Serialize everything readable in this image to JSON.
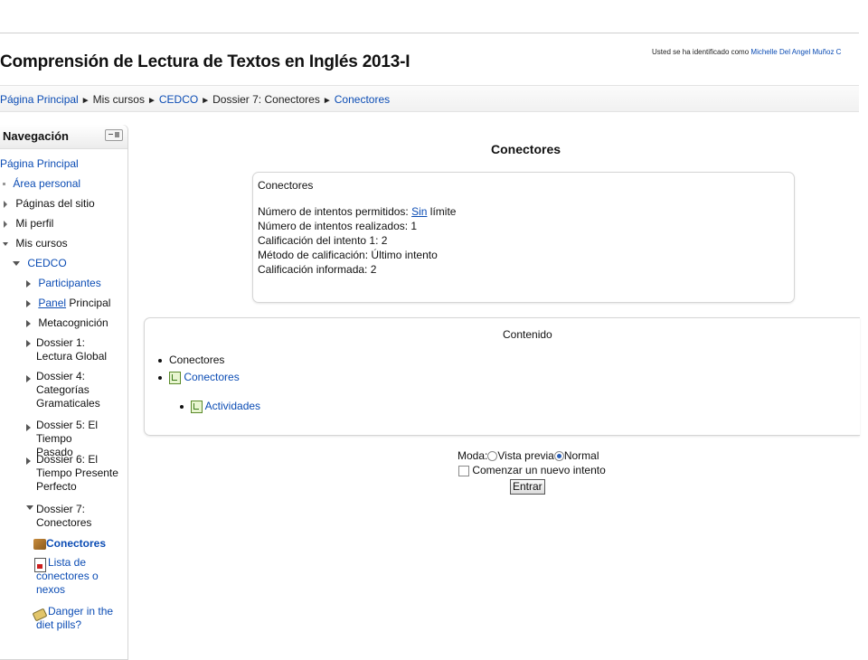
{
  "header": {
    "site_title": "Comprensión de Lectura de Textos en Inglés 2013-I",
    "login_prefix": "Usted se ha identificado como",
    "user_name": "Michelle Del Angel Muñoz C"
  },
  "breadcrumb": {
    "items": [
      "Página Principal",
      "Mis cursos",
      "CEDCO",
      "Dossier 7: Conectores",
      "Conectores"
    ],
    "separator": "►"
  },
  "navigation": {
    "title": "Navegación",
    "home": "Página Principal",
    "personal_area": "Área personal",
    "site_pages": "Páginas del sitio",
    "my_profile": "Mi perfil",
    "my_courses": "Mis cursos",
    "course": "CEDCO",
    "participants": "Participantes",
    "panel_link": "Panel",
    "panel_rest": "Principal",
    "metacognition": "Metacognición",
    "dossier1": "Dossier 1: Lectura Global",
    "dossier4": "Dossier 4: Categorías Gramaticales",
    "dossier5": "Dossier 5: El Tiempo Pasado",
    "dossier6": "Dossier 6: El Tiempo Presente Perfecto",
    "dossier7": "Dossier 7: Conectores",
    "activity_conectores": "Conectores",
    "activity_lista": "Lista de conectores o nexos",
    "activity_danger": "Danger in the diet pills?"
  },
  "main": {
    "heading": "Conectores",
    "summary": {
      "name": "Conectores",
      "attempts_allowed_label": "Número de intentos permitidos:",
      "attempts_allowed_link": "Sin",
      "attempts_allowed_rest": "límite",
      "attempts_made": "Número de intentos realizados: 1",
      "attempt_grade": "Calificación del intento 1: 2",
      "grading_method": "Método de calificación: Último intento",
      "reported_grade": "Calificación informada: 2"
    },
    "content": {
      "title": "Contenido",
      "item1": "Conectores",
      "item2": "Conectores",
      "item3": "Actividades"
    },
    "mode_label": "Moda:",
    "mode_preview": "Vista previa",
    "mode_normal": "Normal",
    "mode_selected": "Normal",
    "new_attempt_label": "Comenzar un nuevo intento",
    "new_attempt_checked": false,
    "enter_button": "Entrar"
  },
  "colors": {
    "link": "#0b4cb4",
    "text": "#111111",
    "border": "#d5d5d5"
  }
}
